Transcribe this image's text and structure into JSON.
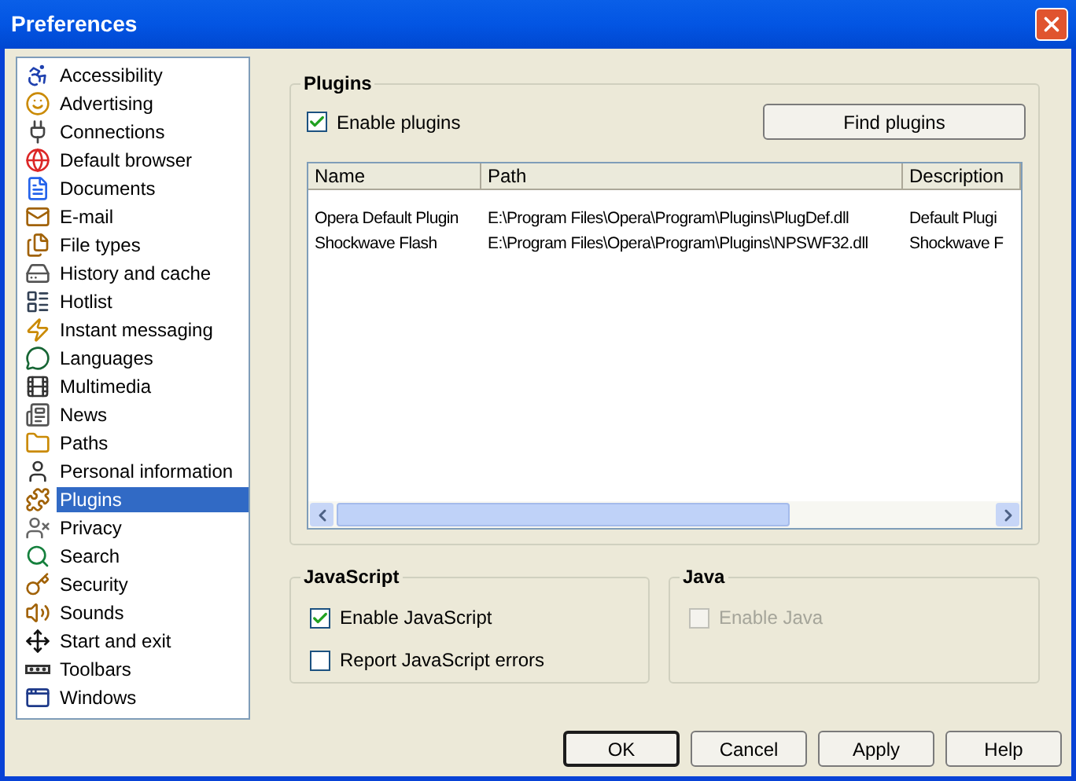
{
  "window": {
    "title": "Preferences"
  },
  "sidebar": {
    "items": [
      {
        "label": "Accessibility",
        "selected": false
      },
      {
        "label": "Advertising",
        "selected": false
      },
      {
        "label": "Connections",
        "selected": false
      },
      {
        "label": "Default browser",
        "selected": false
      },
      {
        "label": "Documents",
        "selected": false
      },
      {
        "label": "E-mail",
        "selected": false
      },
      {
        "label": "File types",
        "selected": false
      },
      {
        "label": "History and cache",
        "selected": false
      },
      {
        "label": "Hotlist",
        "selected": false
      },
      {
        "label": "Instant messaging",
        "selected": false
      },
      {
        "label": "Languages",
        "selected": false
      },
      {
        "label": "Multimedia",
        "selected": false
      },
      {
        "label": "News",
        "selected": false
      },
      {
        "label": "Paths",
        "selected": false
      },
      {
        "label": "Personal information",
        "selected": false
      },
      {
        "label": "Plugins",
        "selected": true
      },
      {
        "label": "Privacy",
        "selected": false
      },
      {
        "label": "Search",
        "selected": false
      },
      {
        "label": "Security",
        "selected": false
      },
      {
        "label": "Sounds",
        "selected": false
      },
      {
        "label": "Start and exit",
        "selected": false
      },
      {
        "label": "Toolbars",
        "selected": false
      },
      {
        "label": "Windows",
        "selected": false
      }
    ]
  },
  "plugins": {
    "title": "Plugins",
    "enable": {
      "label": "Enable plugins",
      "checked": true,
      "disabled": false
    },
    "find_button": "Find plugins",
    "table": {
      "columns": [
        "Name",
        "Path",
        "Description"
      ],
      "rows": [
        [
          "Opera Default Plugin",
          "E:\\Program Files\\Opera\\Program\\Plugins\\PlugDef.dll",
          "Default Plugi"
        ],
        [
          "Shockwave Flash",
          "E:\\Program Files\\Opera\\Program\\Plugins\\NPSWF32.dll",
          "Shockwave F"
        ]
      ]
    }
  },
  "javascript": {
    "title": "JavaScript",
    "options": [
      {
        "label": "Enable JavaScript",
        "checked": true,
        "disabled": false
      },
      {
        "label": "Report JavaScript errors",
        "checked": false,
        "disabled": false
      }
    ]
  },
  "java": {
    "title": "Java",
    "options": [
      {
        "label": "Enable Java",
        "checked": false,
        "disabled": true
      }
    ]
  },
  "buttons": [
    {
      "label": "OK",
      "default": true
    },
    {
      "label": "Cancel",
      "default": false
    },
    {
      "label": "Apply",
      "default": false
    },
    {
      "label": "Help",
      "default": false
    }
  ]
}
